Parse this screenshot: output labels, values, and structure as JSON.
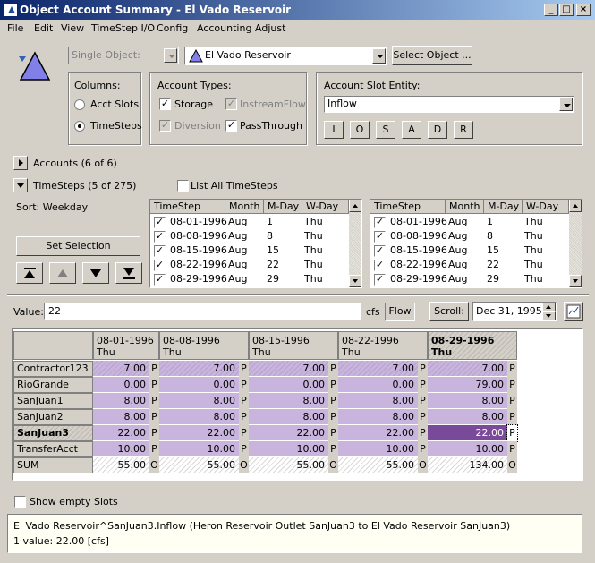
{
  "window": {
    "title": "Object Account Summary - El Vado Reservoir"
  },
  "menu": [
    "File",
    "Edit",
    "View",
    "TimeStep I/O",
    "Config",
    "Accounting",
    "Adjust"
  ],
  "object_selector": {
    "mode_value": "Single Object:",
    "object_value": "El Vado Reservoir",
    "select_button": "Select Object ..."
  },
  "columns_group": {
    "title": "Columns:",
    "options": [
      "Acct Slots",
      "TimeSteps"
    ],
    "selected": "TimeSteps"
  },
  "account_types": {
    "title": "Account Types:",
    "items": [
      {
        "label": "Storage",
        "checked": true,
        "enabled": true
      },
      {
        "label": "InstreamFlow",
        "checked": true,
        "enabled": false
      },
      {
        "label": "Diversion",
        "checked": true,
        "enabled": false
      },
      {
        "label": "PassThrough",
        "checked": true,
        "enabled": true
      }
    ]
  },
  "slot_entity": {
    "title": "Account Slot Entity:",
    "value": "Inflow",
    "buttons": [
      "I",
      "O",
      "S",
      "A",
      "D",
      "R"
    ]
  },
  "accounts_toggle": "Accounts (6 of 6)",
  "timesteps_toggle": "TimeSteps (5 of 275)",
  "list_all_timesteps": "List All TimeSteps",
  "sort_label": "Sort: Weekday",
  "set_selection": "Set Selection",
  "timestep_list": {
    "headers": [
      "TimeStep",
      "Month",
      "M-Day",
      "W-Day"
    ],
    "rows": [
      [
        "08-01-1996",
        "Aug",
        "1",
        "Thu"
      ],
      [
        "08-08-1996",
        "Aug",
        "8",
        "Thu"
      ],
      [
        "08-15-1996",
        "Aug",
        "15",
        "Thu"
      ],
      [
        "08-22-1996",
        "Aug",
        "22",
        "Thu"
      ],
      [
        "08-29-1996",
        "Aug",
        "29",
        "Thu"
      ]
    ]
  },
  "value_bar": {
    "label": "Value:",
    "value": "22",
    "units": "cfs",
    "type_button": "Flow",
    "scroll_button": "Scroll:",
    "date_value": "Dec 31, 1995"
  },
  "grid": {
    "columns": [
      {
        "date": "08-01-1996",
        "day": "Thu"
      },
      {
        "date": "08-08-1996",
        "day": "Thu"
      },
      {
        "date": "08-15-1996",
        "day": "Thu"
      },
      {
        "date": "08-22-1996",
        "day": "Thu"
      },
      {
        "date": "08-29-1996",
        "day": "Thu"
      }
    ],
    "rows": [
      {
        "name": "Contractor123",
        "values": [
          "7.00",
          "7.00",
          "7.00",
          "7.00",
          "7.00"
        ],
        "flags": [
          "P",
          "P",
          "P",
          "P",
          "P"
        ]
      },
      {
        "name": "RioGrande",
        "values": [
          "0.00",
          "0.00",
          "0.00",
          "0.00",
          "79.00"
        ],
        "flags": [
          "P",
          "P",
          "P",
          "P",
          "P"
        ]
      },
      {
        "name": "SanJuan1",
        "values": [
          "8.00",
          "8.00",
          "8.00",
          "8.00",
          "8.00"
        ],
        "flags": [
          "P",
          "P",
          "P",
          "P",
          "P"
        ]
      },
      {
        "name": "SanJuan2",
        "values": [
          "8.00",
          "8.00",
          "8.00",
          "8.00",
          "8.00"
        ],
        "flags": [
          "P",
          "P",
          "P",
          "P",
          "P"
        ]
      },
      {
        "name": "SanJuan3",
        "values": [
          "22.00",
          "22.00",
          "22.00",
          "22.00",
          "22.00"
        ],
        "flags": [
          "P",
          "P",
          "P",
          "P",
          "P"
        ]
      },
      {
        "name": "TransferAcct",
        "values": [
          "10.00",
          "10.00",
          "10.00",
          "10.00",
          "10.00"
        ],
        "flags": [
          "P",
          "P",
          "P",
          "P",
          "P"
        ]
      },
      {
        "name": "SUM",
        "values": [
          "55.00",
          "55.00",
          "55.00",
          "55.00",
          "134.00"
        ],
        "flags": [
          "O",
          "O",
          "O",
          "O",
          "O"
        ]
      }
    ]
  },
  "show_empty_slots": "Show empty Slots",
  "status": {
    "line1": "El Vado Reservoir^SanJuan3.Inflow (Heron Reservoir Outlet SanJuan3 to El Vado Reservoir SanJuan3)",
    "line2": "1 value:  22.00 [cfs]"
  },
  "colors": {
    "cell_purple": "#c8b4dc",
    "cell_selected": "#7a4a9a",
    "title_blue": "#0a246a"
  }
}
